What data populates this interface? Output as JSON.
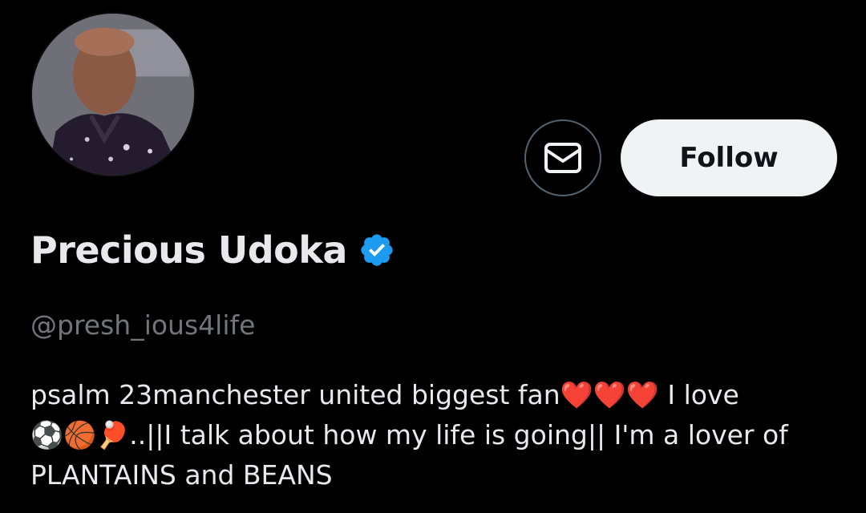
{
  "profile": {
    "display_name": "Precious Udoka",
    "handle": "@presh_ious4life",
    "verified": true,
    "bio_lines": [
      "psalm 23manchester united biggest fan❤️❤️❤️ I love",
      "⚽🏀🏓..||I talk about how my life is going|| I'm a lover of",
      "PLANTAINS and BEANS"
    ]
  },
  "actions": {
    "follow_label": "Follow",
    "message_icon": "envelope-icon"
  },
  "colors": {
    "background": "#000000",
    "primary_text": "#e7e9ea",
    "secondary_text": "#71767b",
    "verified_blue": "#1d9bf0",
    "follow_bg": "#eff3f4",
    "icon_border": "#536471"
  }
}
